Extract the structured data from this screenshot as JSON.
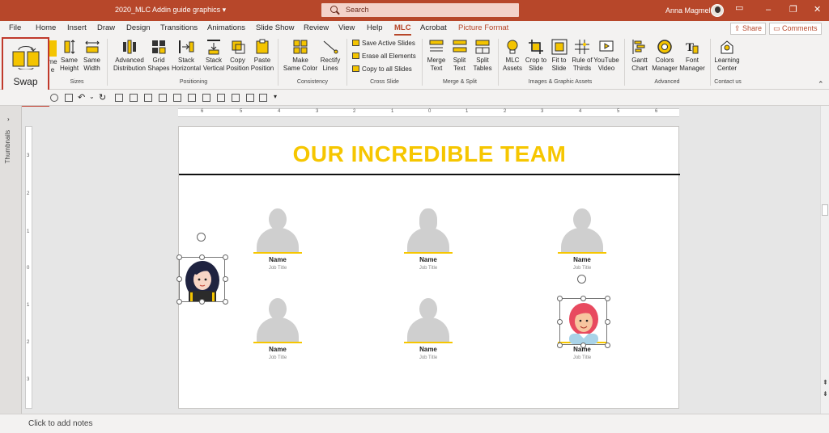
{
  "titlebar": {
    "doc_name": "2020_MLC Addin guide graphics ▾",
    "search_placeholder": "Search",
    "user_name": "Anna Magmel",
    "minimize": "–",
    "restore": "❐",
    "close": "✕"
  },
  "tabs": [
    "File",
    "Home",
    "Insert",
    "Draw",
    "Design",
    "Transitions",
    "Animations",
    "Slide Show",
    "Review",
    "View",
    "Help",
    "MLC",
    "Acrobat",
    "Picture Format"
  ],
  "active_tab": "MLC",
  "share_label": "Share",
  "comments_label": "Comments",
  "ribbon": {
    "swap": "Swap Shapes",
    "sizes": {
      "partial": "me",
      "partial2": "e",
      "same_height": [
        "Same",
        "Height"
      ],
      "same_width": [
        "Same",
        "Width"
      ],
      "group": "Sizes"
    },
    "positioning": {
      "items": [
        [
          "Advanced",
          "Distribution"
        ],
        [
          "Grid",
          "Shapes"
        ],
        [
          "Stack",
          "Horizontal"
        ],
        [
          "Stack",
          "Vertical"
        ],
        [
          "Copy",
          "Position"
        ],
        [
          "Paste",
          "Position"
        ]
      ],
      "group": "Positioning"
    },
    "consistency": {
      "items": [
        [
          "Make",
          "Same Color"
        ],
        [
          "Rectify",
          "Lines"
        ]
      ],
      "group": "Consistency"
    },
    "cross_slide": {
      "items": [
        "Save Active Slides",
        "Erase all Elements",
        "Copy to all Slides"
      ],
      "group": "Cross Slide"
    },
    "merge_split": {
      "items": [
        [
          "Merge",
          "Text"
        ],
        [
          "Split",
          "Text"
        ],
        [
          "Split",
          "Tables"
        ]
      ],
      "group": "Merge & Split"
    },
    "images": {
      "items": [
        [
          "MLC",
          "Assets"
        ],
        [
          "Crop to",
          "Slide"
        ],
        [
          "Fit to",
          "Slide"
        ],
        [
          "Rule of",
          "Thirds"
        ],
        [
          "YouTube",
          "Video"
        ]
      ],
      "group": "Images & Graphic Assets"
    },
    "advanced": {
      "items": [
        [
          "Gantt",
          "Chart"
        ],
        [
          "Colors",
          "Manager"
        ],
        [
          "Font",
          "Manager"
        ]
      ],
      "group": "Advanced"
    },
    "contact": {
      "items": [
        [
          "Learning",
          "Center"
        ]
      ],
      "group": "Contact us"
    }
  },
  "thumbnails_label": "Thumbnails",
  "ruler": {
    "h": [
      "6",
      "5",
      "4",
      "3",
      "2",
      "1",
      "0",
      "1",
      "2",
      "3",
      "4",
      "5",
      "6"
    ],
    "v": [
      "3",
      "2",
      "1",
      "0",
      "1",
      "2",
      "3"
    ]
  },
  "slide": {
    "title": "OUR INCREDIBLE TEAM",
    "members": [
      {
        "name": "Name",
        "job": "Job Title"
      },
      {
        "name": "Name",
        "job": "Job Title"
      },
      {
        "name": "Name",
        "job": "Job Title"
      },
      {
        "name": "Name",
        "job": "Job Title"
      },
      {
        "name": "Name",
        "job": "Job Title"
      },
      {
        "name": "Name",
        "job": "Job Title"
      }
    ]
  },
  "status": {
    "notes": "Click to add notes"
  },
  "colors": {
    "accent": "#b7472a",
    "title_yellow": "#f6c600"
  }
}
